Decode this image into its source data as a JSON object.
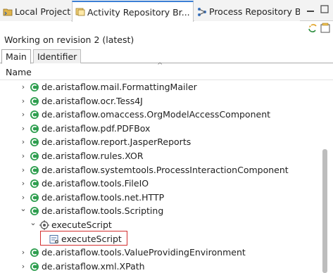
{
  "tabs": [
    {
      "label": "Local Projects",
      "icon": "projects-icon",
      "active": false
    },
    {
      "label": "Activity Repository Br...",
      "icon": "activity-repository-icon",
      "active": true,
      "close": "×"
    },
    {
      "label": "Process Repository Br...",
      "icon": "process-repository-icon",
      "active": false
    }
  ],
  "revision_text": "Working on revision 2 (latest)",
  "subtabs": [
    {
      "label": "Main",
      "active": true
    },
    {
      "label": "Identifier",
      "active": false
    }
  ],
  "tree": {
    "column_header": "Name",
    "sort_indicator": "^",
    "rows": [
      {
        "label": "de.aristaflow.mail.FormattingMailer",
        "level": 0,
        "expander": "›",
        "icon": "component-icon"
      },
      {
        "label": "de.aristaflow.ocr.Tess4J",
        "level": 0,
        "expander": "›",
        "icon": "component-icon"
      },
      {
        "label": "de.aristaflow.omaccess.OrgModelAccessComponent",
        "level": 0,
        "expander": "›",
        "icon": "component-icon"
      },
      {
        "label": "de.aristaflow.pdf.PDFBox",
        "level": 0,
        "expander": "›",
        "icon": "component-icon"
      },
      {
        "label": "de.aristaflow.report.JasperReports",
        "level": 0,
        "expander": "›",
        "icon": "component-icon"
      },
      {
        "label": "de.aristaflow.rules.XOR",
        "level": 0,
        "expander": "›",
        "icon": "component-icon"
      },
      {
        "label": "de.aristaflow.systemtools.ProcessInteractionComponent",
        "level": 0,
        "expander": "›",
        "icon": "component-icon"
      },
      {
        "label": "de.aristaflow.tools.FileIO",
        "level": 0,
        "expander": "›",
        "icon": "component-icon"
      },
      {
        "label": "de.aristaflow.tools.net.HTTP",
        "level": 0,
        "expander": "›",
        "icon": "component-icon"
      },
      {
        "label": "de.aristaflow.tools.Scripting",
        "level": 0,
        "expander": "⌄",
        "icon": "component-icon"
      },
      {
        "label": "executeScript",
        "level": 1,
        "expander": "⌄",
        "icon": "operation-icon"
      },
      {
        "label": "executeScript",
        "level": 2,
        "expander": "",
        "icon": "script-icon",
        "highlighted": true
      },
      {
        "label": "de.aristaflow.tools.ValueProvidingEnvironment",
        "level": 0,
        "expander": "›",
        "icon": "component-icon"
      },
      {
        "label": "de.aristaflow.xml.XPath",
        "level": 0,
        "expander": "›",
        "icon": "component-icon"
      }
    ]
  },
  "colors": {
    "component_icon": "#2e9e4f",
    "highlight_border": "#d32f2f",
    "active_tab_accent": "#3b7fd6"
  }
}
